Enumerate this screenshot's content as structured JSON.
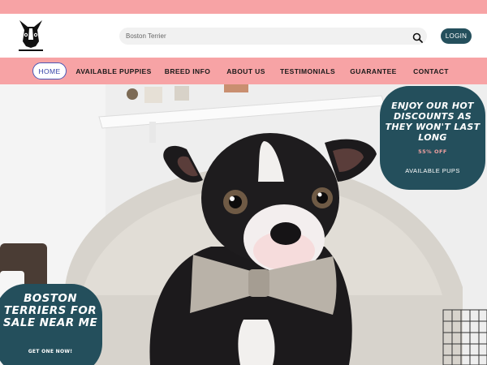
{
  "header": {
    "logo_icon": "boston-terrier-logo-icon",
    "search": {
      "value": "Boston Terrier",
      "placeholder": "Boston Terrier",
      "icon": "search-icon"
    },
    "login_label": "LOGIN"
  },
  "nav": {
    "items": [
      {
        "label": "HOME",
        "active": true
      },
      {
        "label": "AVAILABLE PUPPIES"
      },
      {
        "label": "BREED INFO"
      },
      {
        "label": "ABOUT US"
      },
      {
        "label": "TESTIMONIALS"
      },
      {
        "label": "GUARANTEE"
      },
      {
        "label": "CONTACT"
      }
    ]
  },
  "hero": {
    "image": "boston-terrier-puppy-with-bow-tie",
    "promo_right": {
      "title": "ENJOY OUR HOT DISCOUNTS AS THEY WON'T LAST LONG",
      "discount": "55% OFF",
      "link": "AVAILABLE PUPS"
    },
    "promo_left": {
      "title": "BOSTON TERRIERS FOR SALE NEAR ME",
      "cta": "GET ONE NOW!"
    }
  },
  "colors": {
    "pink": "#f7a3a5",
    "teal": "#244f5c",
    "nav_active": "#4b57b6"
  }
}
